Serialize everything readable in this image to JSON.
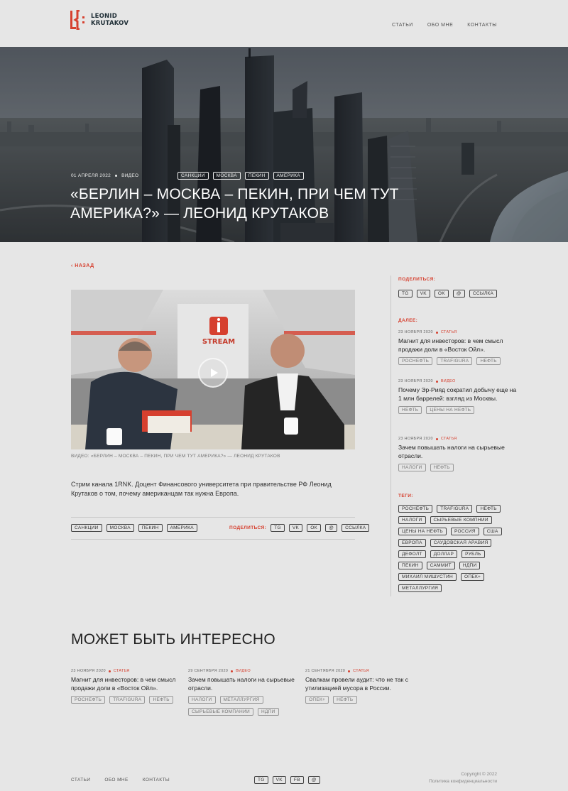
{
  "header": {
    "logo_line1": "LEONID",
    "logo_line2": "KRUTAKOV",
    "nav": [
      "СТАТЬИ",
      "ОБО МНЕ",
      "КОНТАКТЫ"
    ]
  },
  "hero": {
    "date": "01 АПРЕЛЯ 2022",
    "kind": "ВИДЕО",
    "tags": [
      "САНКЦИИ",
      "МОСКВА",
      "ПЕКИН",
      "АМЕРИКА"
    ],
    "title": "«БЕРЛИН – МОСКВА – ПЕКИН, ПРИ ЧЕМ ТУТ АМЕРИКА?» — ЛЕОНИД КРУТАКОВ"
  },
  "back_label": "НАЗАД",
  "video": {
    "brand": "STREAM",
    "caption": "ВИДЕО: «БЕРЛИН – МОСКВА – ПЕКИН, ПРИ ЧЕМ ТУТ АМЕРИКА?» — ЛЕОНИД КРУТАКОВ"
  },
  "lede": "Стрим канала 1RNK. Доцент Финансового университета при правительстве РФ Леонид Крутаков о том, почему американцам так нужна Европа.",
  "article_tags": [
    "САНКЦИИ",
    "МОСКВА",
    "ПЕКИН",
    "АМЕРИКА"
  ],
  "share": {
    "label": "ПОДЕЛИТЬСЯ:",
    "items": [
      "TG",
      "VK",
      "OK",
      "@",
      "ССЫЛКА"
    ]
  },
  "sidebar": {
    "share_label": "ПОДЕЛИТЬСЯ:",
    "next_label": "ДАЛЕЕ:",
    "next": [
      {
        "date": "23 НОЯБРЯ 2020",
        "kind": "СТАТЬЯ",
        "title": "Магнит для инвесторов: в чем смысл продажи доли в «Восток Ойл».",
        "tags": [
          "РОСНЕФТЬ",
          "TRAFIGURA",
          "НЕФТЬ"
        ]
      },
      {
        "date": "23 НОЯБРЯ 2020",
        "kind": "ВИДЕО",
        "title": "Почему Эр-Рияд сократил добычу еще на 1 млн баррелей: взгляд из Москвы.",
        "tags": [
          "НЕФТЬ",
          "ЦЕНЫ НА НЕФТЬ"
        ]
      },
      {
        "date": "23 НОЯБРЯ 2020",
        "kind": "СТАТЬЯ",
        "title": "Зачем повышать налоги на сырьевые отрасли.",
        "tags": [
          "НАЛОГИ",
          "НЕФТЬ"
        ]
      }
    ],
    "tags_label": "ТЕГИ:",
    "tags": [
      [
        "РОСНЕФТЬ",
        "TRAFIGURA",
        "НЕФТЬ"
      ],
      [
        "НАЛОГИ",
        "СЫРЬЕВЫЕ КОМПНИИ"
      ],
      [
        "ЦЕНЫ НА НЕФТЬ",
        "РОССИЯ",
        "США"
      ],
      [
        "ЕВРОПА",
        "САУДОВСКАЯ АРАВИЯ"
      ],
      [
        "ДЕФОЛТ",
        "ДОЛЛАР",
        "РУБЛЬ"
      ],
      [
        "ПЕКИН",
        "САММИТ",
        "НДПИ"
      ],
      [
        "МИХАИЛ МИШУСТИН",
        "ОПЕК+"
      ],
      [
        "МЕТАЛЛУРГИЯ"
      ]
    ]
  },
  "related": {
    "title": "МОЖЕТ БЫТЬ ИНТЕРЕСНО",
    "items": [
      {
        "date": "23 НОЯБРЯ 2020",
        "kind": "СТАТЬЯ",
        "title": "Магнит для инвесторов: в чем смысл продажи доли в «Восток Ойл».",
        "tags": [
          "РОСНЕФТЬ",
          "TRAFIGURA",
          "НЕФТЬ"
        ]
      },
      {
        "date": "29 СЕНТЯБРЯ 2020",
        "kind": "ВИДЕО",
        "title": "Зачем повышать налоги на сырьевые отрасли.",
        "tags": [
          "НАЛОГИ",
          "МЕТАЛЛУРГИЯ",
          "СЫРЬЕВЫЕ КОМПАНИИ",
          "НДПИ"
        ]
      },
      {
        "date": "21 СЕНТЯБРЯ 2020",
        "kind": "СТАТЬЯ",
        "title": "Свалкам провели аудит: что не так с утилизацией мусора в России.",
        "tags": [
          "ОПЕК+",
          "НЕФТЬ"
        ]
      }
    ]
  },
  "footer": {
    "nav": [
      "СТАТЬИ",
      "ОБО МНЕ",
      "КОНТАКТЫ"
    ],
    "social": [
      "TG",
      "VK",
      "FB",
      "@"
    ],
    "copyright": "Copyright © 2022",
    "privacy": "Политика конфиденциальности"
  },
  "colors": {
    "accent": "#d6402f",
    "background": "#e6e6e6"
  }
}
